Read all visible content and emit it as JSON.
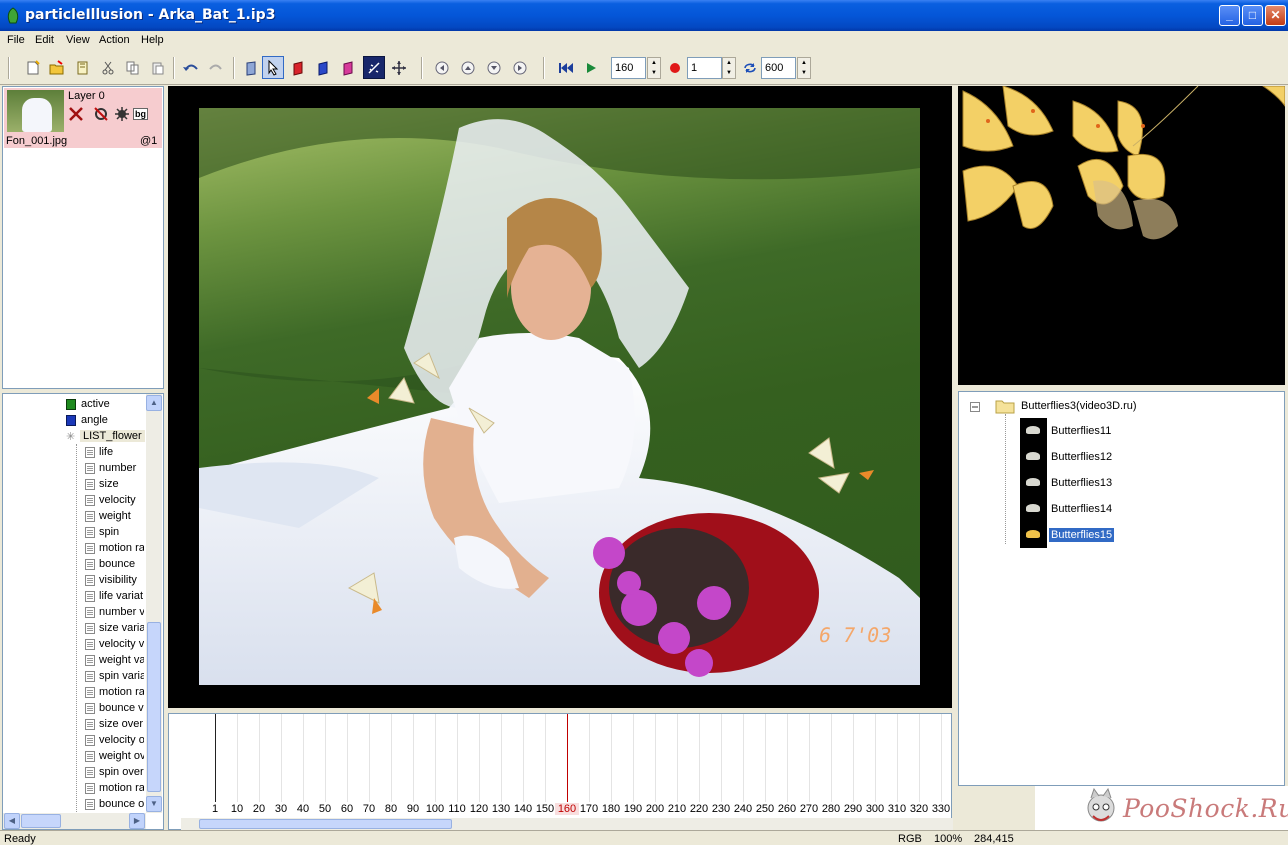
{
  "window": {
    "title": "particleIllusion - Arka_Bat_1.ip3",
    "minimize": "_",
    "maximize": "□",
    "close": "✕"
  },
  "menu": [
    "File",
    "Edit",
    "View",
    "Action",
    "Help"
  ],
  "toolbar": {
    "frame_value": "160",
    "step_value": "1",
    "end_value": "600",
    "icons": [
      "new-file",
      "open-file",
      "save",
      "cut",
      "copy",
      "paste",
      "undo",
      "redo",
      "emitter",
      "select-arrow",
      "red-layer",
      "blue-layer",
      "pink-layer",
      "particle-view",
      "move",
      "key-prev",
      "key-add",
      "key-del",
      "key-next",
      "rewind",
      "play",
      "record",
      "loop"
    ]
  },
  "layers": {
    "name": "Layer 0",
    "file": "Fon_001.jpg",
    "frame": "@1",
    "bg_label": "bg"
  },
  "tree": [
    {
      "label": "active",
      "level": 1,
      "icon": "green"
    },
    {
      "label": "angle",
      "level": 1,
      "icon": "blue"
    },
    {
      "label": "LIST_flower",
      "level": 0,
      "icon": "gear"
    },
    {
      "label": "life",
      "level": 2
    },
    {
      "label": "number",
      "level": 2
    },
    {
      "label": "size",
      "level": 2
    },
    {
      "label": "velocity",
      "level": 2
    },
    {
      "label": "weight",
      "level": 2
    },
    {
      "label": "spin",
      "level": 2
    },
    {
      "label": "motion ra",
      "level": 2
    },
    {
      "label": "bounce",
      "level": 2
    },
    {
      "label": "visibility",
      "level": 2
    },
    {
      "label": "life variat",
      "level": 2
    },
    {
      "label": "number v",
      "level": 2
    },
    {
      "label": "size varia",
      "level": 2
    },
    {
      "label": "velocity v",
      "level": 2
    },
    {
      "label": "weight va",
      "level": 2
    },
    {
      "label": "spin varia",
      "level": 2
    },
    {
      "label": "motion ra",
      "level": 2
    },
    {
      "label": "bounce v",
      "level": 2
    },
    {
      "label": "size over",
      "level": 2
    },
    {
      "label": "velocity o",
      "level": 2
    },
    {
      "label": "weight ov",
      "level": 2
    },
    {
      "label": "spin over",
      "level": 2
    },
    {
      "label": "motion ra",
      "level": 2
    },
    {
      "label": "bounce o",
      "level": 2
    }
  ],
  "library": {
    "folder": "Butterflies3(video3D.ru)",
    "items": [
      "Butterflies11",
      "Butterflies12",
      "Butterflies13",
      "Butterflies14",
      "Butterflies15"
    ],
    "selected": "Butterflies15"
  },
  "timeline": {
    "ticks": [
      "1",
      "10",
      "20",
      "30",
      "40",
      "50",
      "60",
      "70",
      "80",
      "90",
      "100",
      "110",
      "120",
      "130",
      "140",
      "150",
      "160",
      "170",
      "180",
      "190",
      "200",
      "210",
      "220",
      "230",
      "240",
      "250",
      "260",
      "270",
      "280",
      "290",
      "300",
      "310",
      "320",
      "330"
    ],
    "current": "160"
  },
  "photo_stamp": "6 7'03",
  "watermark": "PooShock.Ru",
  "status": {
    "left": "Ready",
    "mode": "RGB",
    "zoom": "100%",
    "coords": "284,415"
  },
  "colors": {
    "titlebar": "#0456d8",
    "layer_highlight": "#f6cccf",
    "selection": "#316ac5",
    "playhead": "#c00000"
  }
}
